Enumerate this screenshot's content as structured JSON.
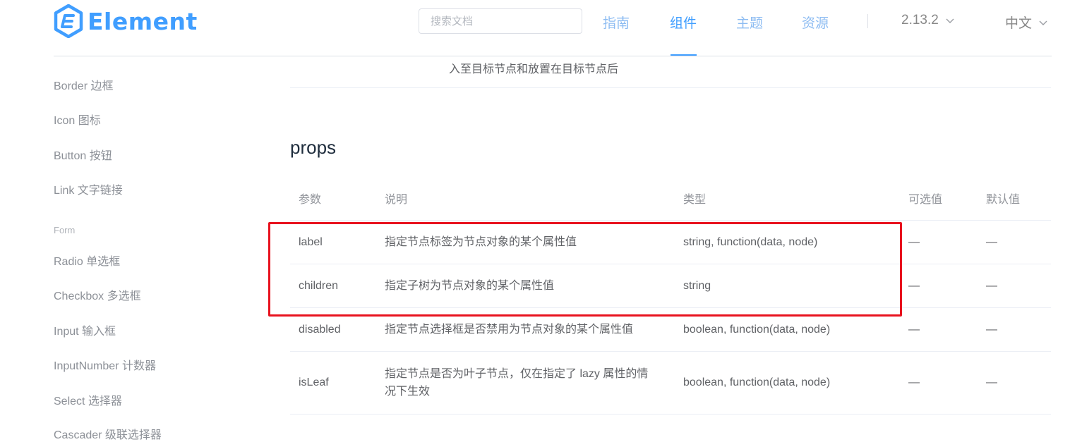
{
  "brand": {
    "name": "Element",
    "color": "#409eff"
  },
  "search": {
    "placeholder": "搜索文档"
  },
  "nav": {
    "guide": "指南",
    "component": "组件",
    "theme": "主题",
    "resource": "资源"
  },
  "version": {
    "label": "2.13.2",
    "icon": "chevron-down-icon"
  },
  "language": {
    "label": "中文",
    "icon": "chevron-down-icon"
  },
  "sidebar": {
    "items": [
      "Border 边框",
      "Icon 图标",
      "Button 按钮",
      "Link 文字链接"
    ],
    "group_form": "Form",
    "form_items": [
      "Radio 单选框",
      "Checkbox 多选框",
      "Input 输入框",
      "InputNumber 计数器",
      "Select 选择器",
      "Cascader 级联选择器"
    ]
  },
  "content": {
    "prev_text": "入至目标节点和放置在目标节点后",
    "section_title": "props",
    "table": {
      "headers": [
        "参数",
        "说明",
        "类型",
        "可选值",
        "默认值"
      ],
      "rows": [
        {
          "param": "label",
          "desc": "指定节点标签为节点对象的某个属性值",
          "type": "string, function(data, node)",
          "options": "—",
          "default": "—"
        },
        {
          "param": "children",
          "desc": "指定子树为节点对象的某个属性值",
          "type": "string",
          "options": "—",
          "default": "—"
        },
        {
          "param": "disabled",
          "desc": "指定节点选择框是否禁用为节点对象的某个属性值",
          "type": "boolean, function(data, node)",
          "options": "—",
          "default": "—"
        },
        {
          "param": "isLeaf",
          "desc": "指定节点是否为叶子节点，仅在指定了 lazy 属性的情况下生效",
          "type": "boolean, function(data, node)",
          "options": "—",
          "default": "—"
        }
      ]
    },
    "highlight_color": "#e8121e"
  }
}
